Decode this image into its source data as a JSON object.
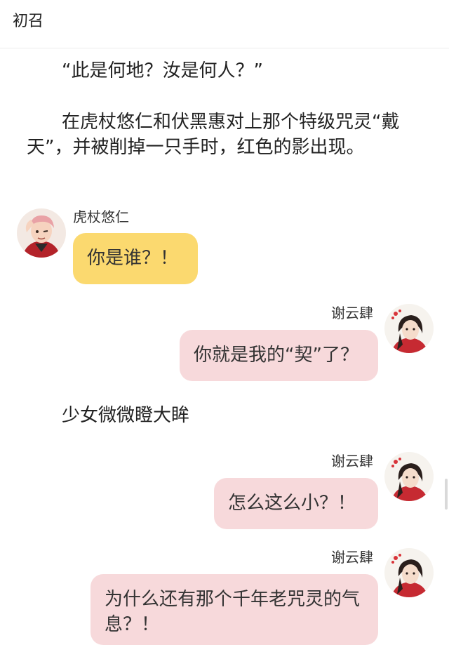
{
  "header": {
    "title": "初召"
  },
  "story": {
    "para1": "“此是何地？汝是何人？”",
    "para2": "在虎杖悠仁和伏黑惠对上那个特级咒灵“戴天”，并被削掉一只手时，红色的影出现。",
    "para3": "少女微微瞪大眸"
  },
  "messages": [
    {
      "sender": "虎杖悠仁",
      "text": "你是谁？！",
      "side": "left",
      "color": "#fbd96f",
      "avatar_icon": "yuji-avatar-icon"
    },
    {
      "sender": "谢云肆",
      "text": "你就是我的“契”了？",
      "side": "right",
      "color": "#f7d9db",
      "avatar_icon": "xie-yunsi-avatar-icon"
    },
    {
      "sender": "谢云肆",
      "text": "怎么这么小？！",
      "side": "right",
      "color": "#f7d9db",
      "avatar_icon": "xie-yunsi-avatar-icon"
    },
    {
      "sender": "谢云肆",
      "text": "为什么还有那个千年老咒灵的气息？！",
      "side": "right",
      "color": "#f7d9db",
      "avatar_icon": "xie-yunsi-avatar-icon"
    }
  ]
}
